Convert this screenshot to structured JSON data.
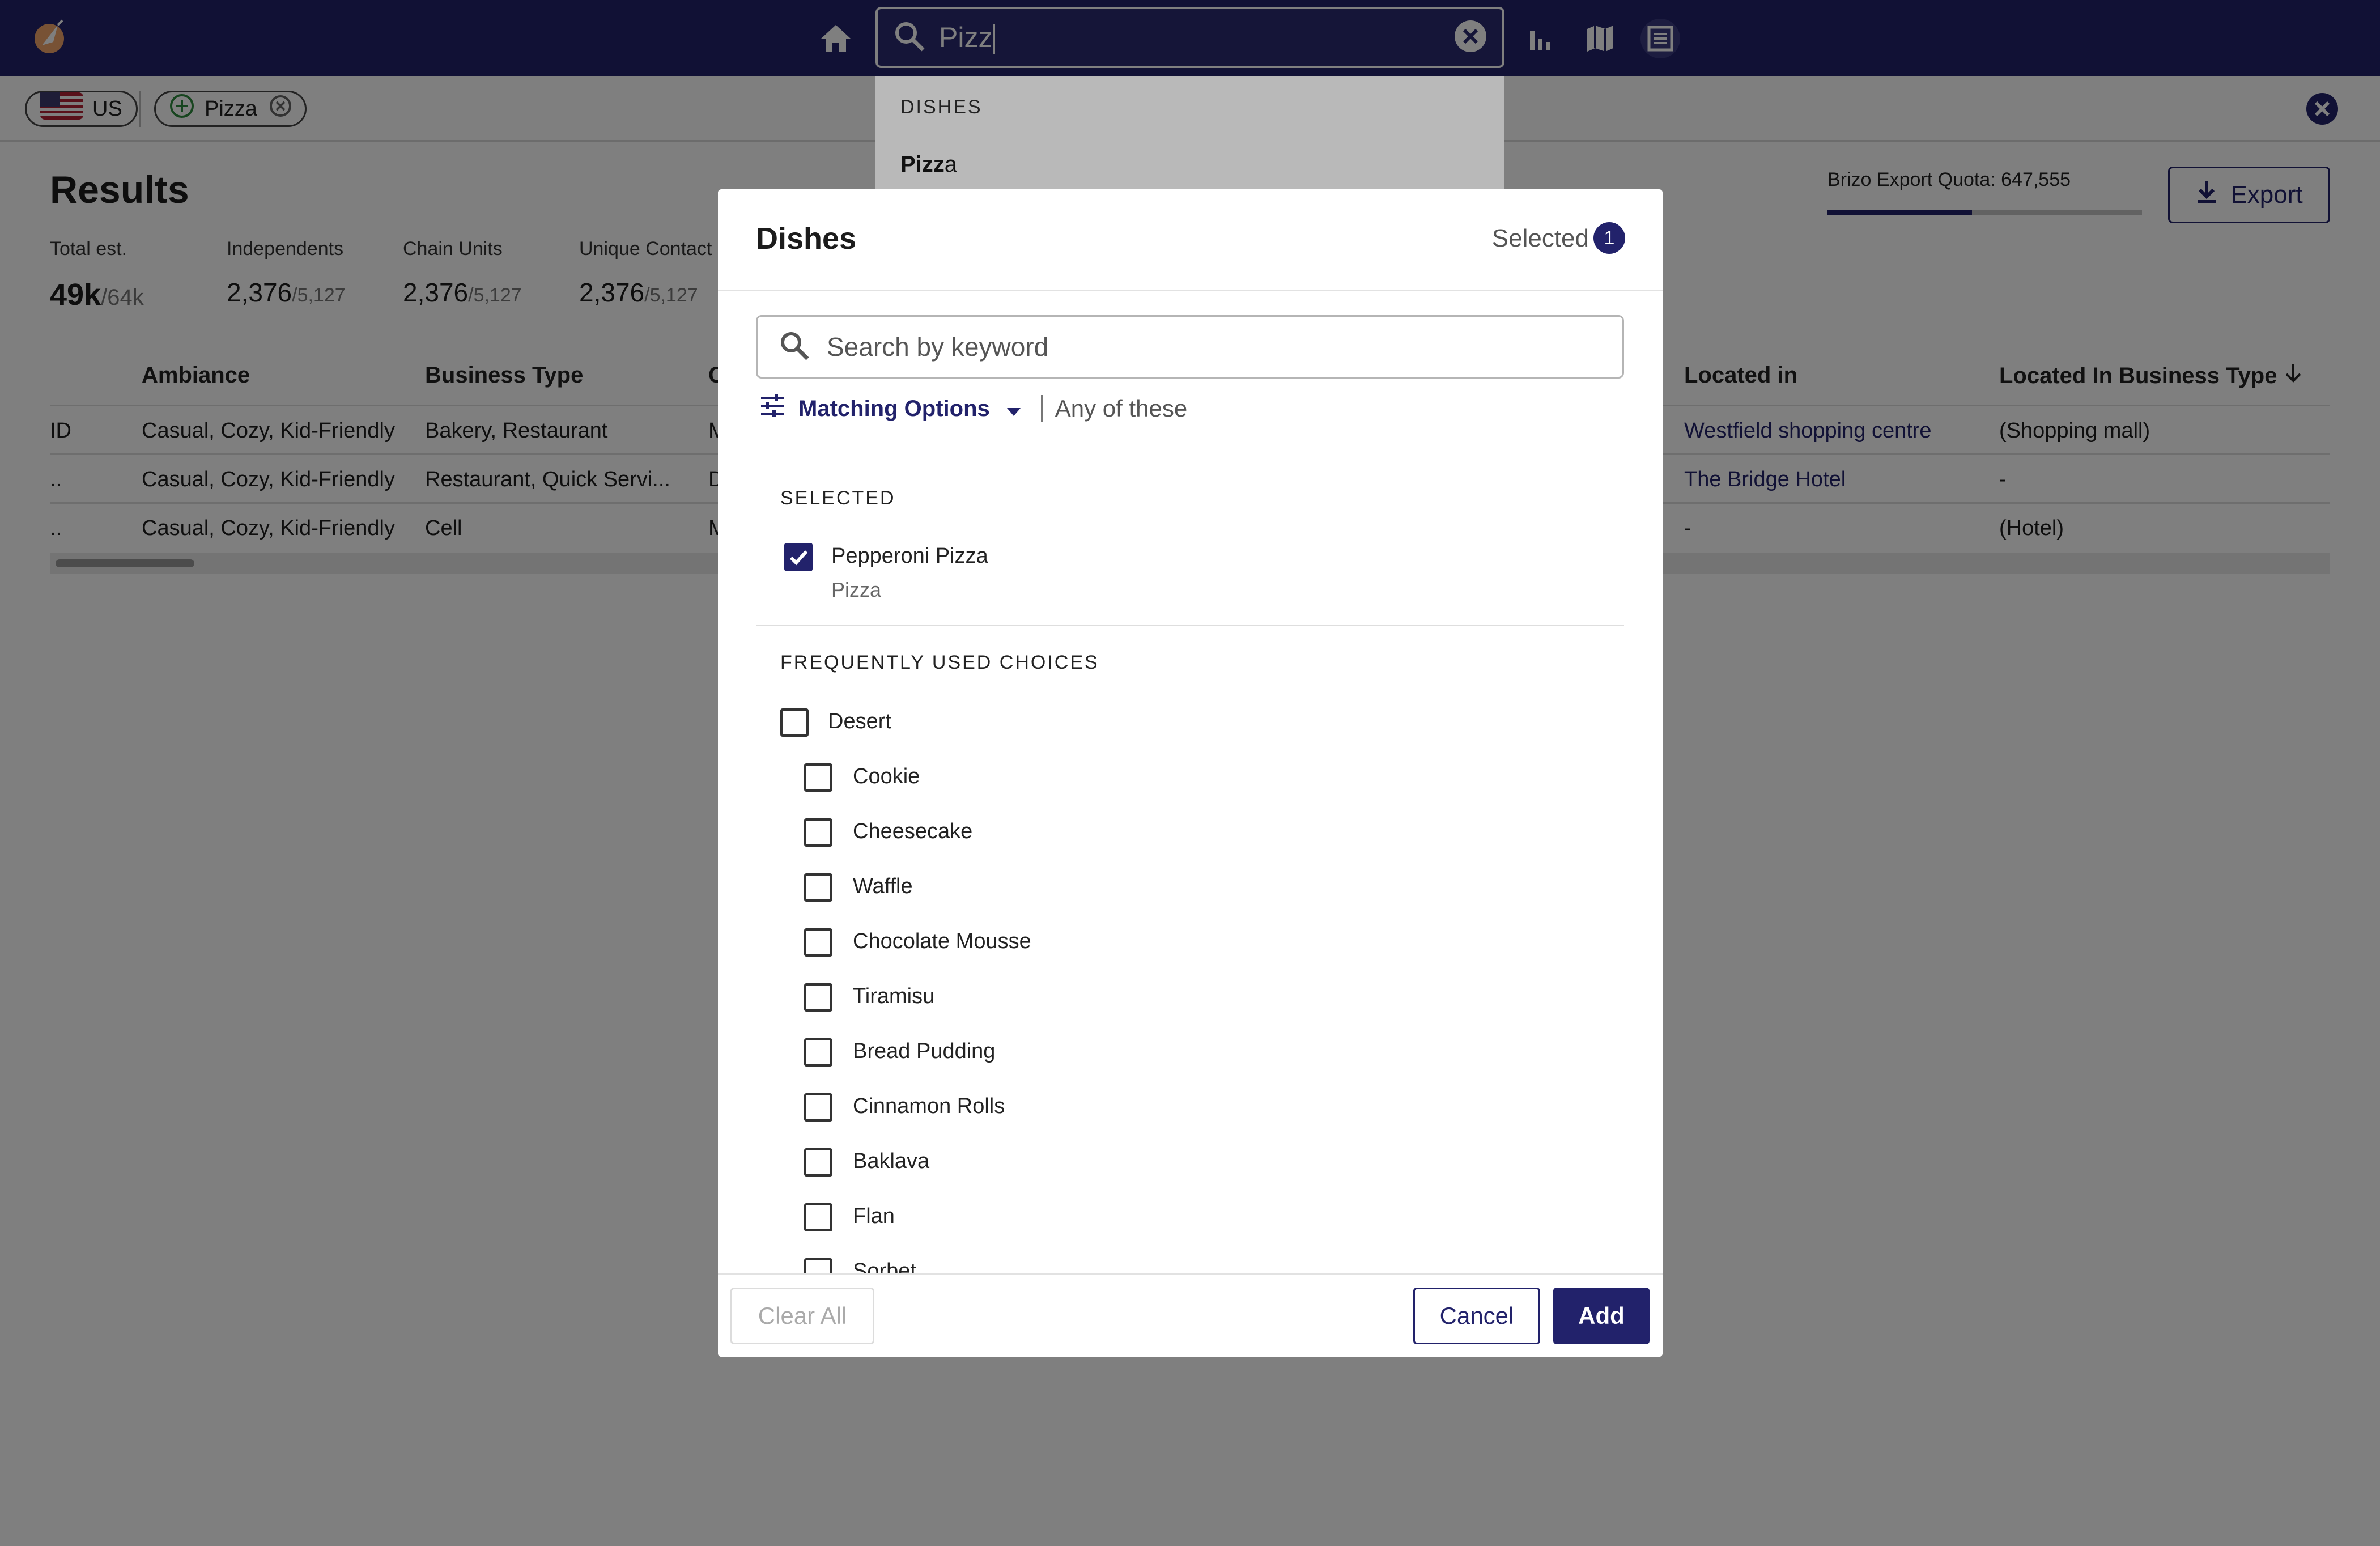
{
  "topbar": {
    "search_value": "Pizz",
    "icons": [
      "home-icon",
      "search-icon",
      "clear-icon",
      "bar-chart-icon",
      "map-icon",
      "table-view-icon"
    ]
  },
  "filters": {
    "country_label": "US",
    "dish_chip_label": "Pizza"
  },
  "autocomplete": {
    "header": "DISHES",
    "item_bold": "Pizz",
    "item_rest": "a"
  },
  "results": {
    "title": "Results",
    "stats": [
      {
        "label": "Total est.",
        "value": "49k",
        "total": "/64k"
      },
      {
        "label": "Independents",
        "value": "2,376",
        "total": "/5,127"
      },
      {
        "label": "Chain Units",
        "value": "2,376",
        "total": "/5,127"
      },
      {
        "label": "Unique Contact",
        "value": "2,376",
        "total": "/5,127"
      }
    ],
    "quota_label": "Brizo Export Quota: 647,555",
    "quota_fraction": 0.46,
    "export_label": "Export"
  },
  "table": {
    "headers": {
      "ambiance": "Ambiance",
      "business_type": "Business Type",
      "partial": "C",
      "located_in": "Located in",
      "located_in_type": "Located In Business Type"
    },
    "rows": [
      {
        "id": "ID",
        "ambiance": "Casual, Cozy, Kid-Friendly",
        "business_type": "Bakery, Restaurant",
        "partial": "M",
        "located_in": "Westfield shopping centre",
        "located_in_type": "(Shopping mall)"
      },
      {
        "id": "..",
        "ambiance": "Casual, Cozy, Kid-Friendly",
        "business_type": "Restaurant, Quick Servi...",
        "partial": "D",
        "located_in": "The Bridge Hotel",
        "located_in_type": "-"
      },
      {
        "id": "..",
        "ambiance": "Casual, Cozy, Kid-Friendly",
        "business_type": "Cell",
        "partial": "M",
        "located_in": "-",
        "located_in_type": "(Hotel)"
      }
    ]
  },
  "modal": {
    "title": "Dishes",
    "selected_label": "Selected",
    "selected_count": "1",
    "search_placeholder": "Search by keyword",
    "matching_options_label": "Matching Options",
    "matching_mode": "Any of these",
    "selected_section": "SELECTED",
    "selected_item": {
      "label": "Pepperoni Pizza",
      "parent": "Pizza",
      "checked": true
    },
    "frequent_section": "FREQUENTLY USED CHOICES",
    "parent_choice": "Desert",
    "choices": [
      "Cookie",
      "Cheesecake",
      "Waffle",
      "Chocolate Mousse",
      "Tiramisu",
      "Bread Pudding",
      "Cinnamon Rolls",
      "Baklava",
      "Flan",
      "Sorbet"
    ],
    "clear_all_label": "Clear All",
    "cancel_label": "Cancel",
    "add_label": "Add"
  },
  "colors": {
    "brand": "#22226b",
    "overlay": "rgba(0,0,0,0.5)"
  }
}
